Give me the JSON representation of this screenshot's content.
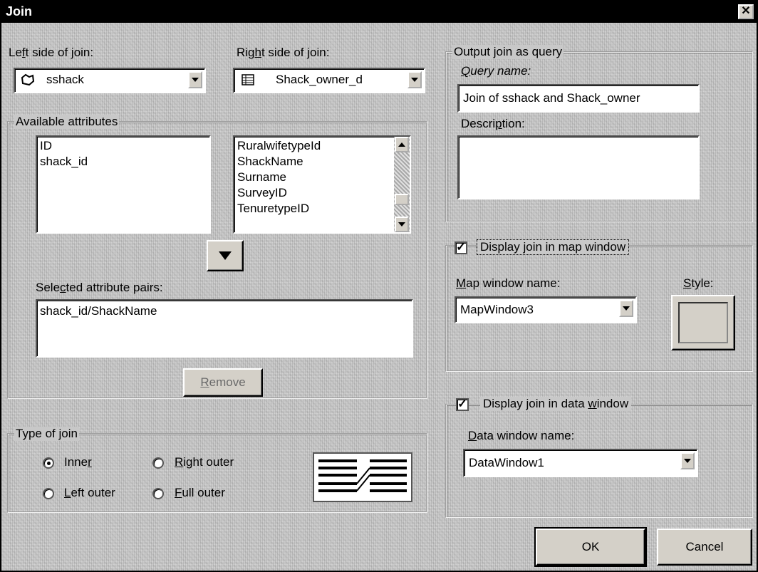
{
  "window": {
    "title": "Join",
    "close_glyph": "✕"
  },
  "left_join": {
    "label_pre": "Le",
    "label_key": "f",
    "label_post": "t side of join:",
    "value": "sshack",
    "icon": "polygon-layer-icon"
  },
  "right_join": {
    "label_pre": "Rig",
    "label_key": "h",
    "label_post": "t side of join:",
    "value": "Shack_owner_d",
    "icon": "table-icon"
  },
  "available": {
    "title": "Available attributes",
    "left_items": [
      "ID",
      "shack_id"
    ],
    "right_items": [
      "RuralwifetypeId",
      "ShackName",
      "Surname",
      "SurveyID",
      "TenuretypeID"
    ]
  },
  "selected_pairs": {
    "label_pre": "Sele",
    "label_key": "c",
    "label_post": "ted attribute pairs:",
    "items": [
      "shack_id/ShackName"
    ]
  },
  "remove_button": {
    "label_key": "R",
    "label_post": "emove"
  },
  "join_type": {
    "title": "Type of join",
    "inner": {
      "pre": "Inne",
      "key": "r",
      "post": "",
      "selected": true
    },
    "right_outer": {
      "pre": "",
      "key": "R",
      "post": "ight outer",
      "selected": false
    },
    "left_outer": {
      "pre": "",
      "key": "L",
      "post": "eft outer",
      "selected": false
    },
    "full_outer": {
      "pre": "",
      "key": "F",
      "post": "ull outer",
      "selected": false
    }
  },
  "output": {
    "title": "Output join as query",
    "query_label_key": "Q",
    "query_label_post": "uery name:",
    "query_value": "Join of sshack and Shack_owner",
    "desc_label_pre": "Descri",
    "desc_label_key": "p",
    "desc_label_post": "tion:",
    "desc_value": ""
  },
  "map_window": {
    "checkbox_label": "Display join in map window",
    "checked": true,
    "name_label_key": "M",
    "name_label_post": "ap window name:",
    "name_value": "MapWindow3",
    "style_label_key": "S",
    "style_label_post": "tyle:"
  },
  "data_window": {
    "checkbox_pre": "Display join in data ",
    "checkbox_key": "w",
    "checkbox_post": "indow",
    "checked": true,
    "name_label_key": "D",
    "name_label_post": "ata window name:",
    "name_value": "DataWindow1"
  },
  "buttons": {
    "ok": "OK",
    "cancel": "Cancel"
  },
  "check_glyph": "✓"
}
